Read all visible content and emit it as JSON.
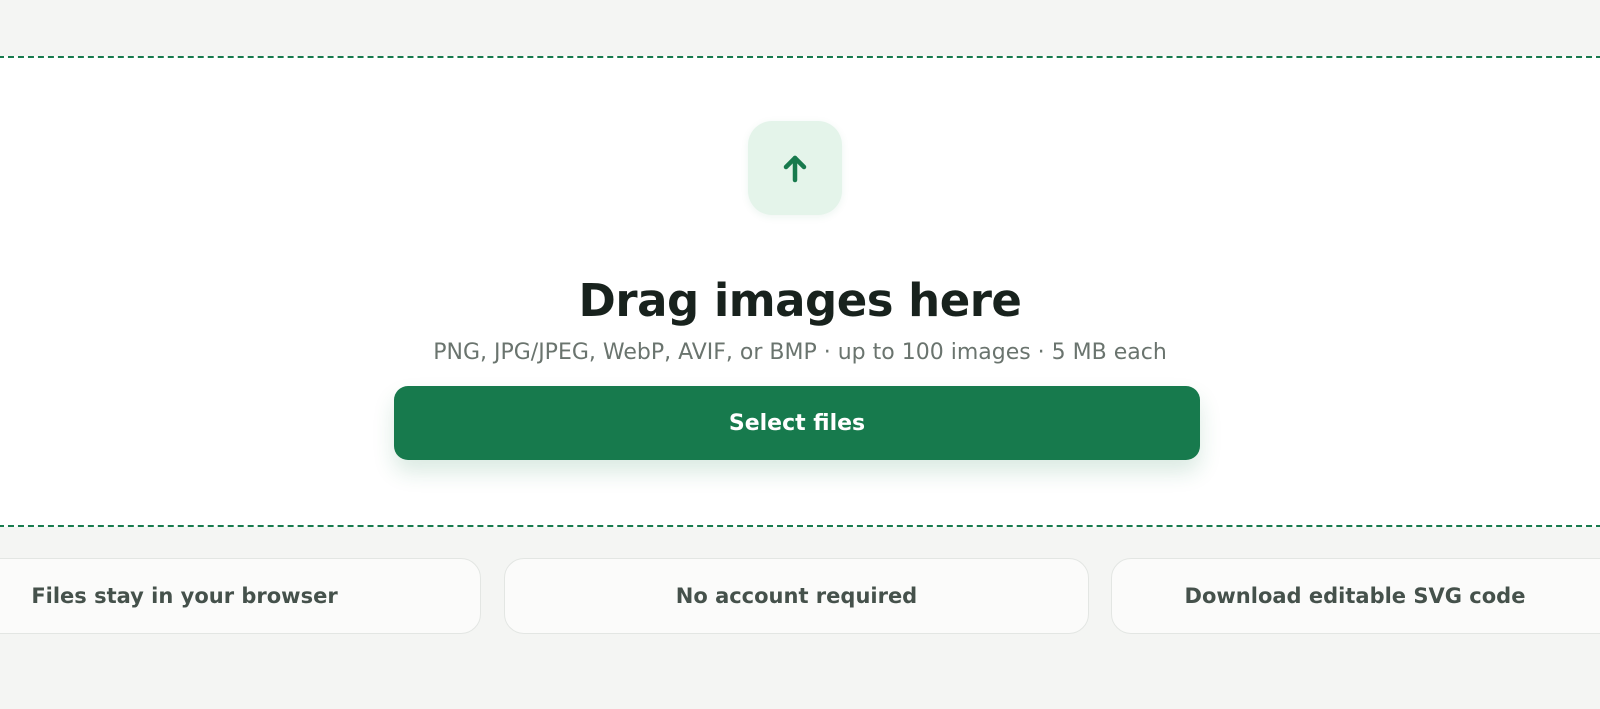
{
  "upload": {
    "icon": "upload-arrow-icon",
    "title": "Drag images here",
    "subtitle": "PNG, JPG/JPEG, WebP, AVIF, or BMP · up to 100 images · 5 MB each",
    "button_label": "Select files"
  },
  "features": [
    {
      "label": "Files stay in your browser"
    },
    {
      "label": "No account required"
    },
    {
      "label": "Download editable SVG code"
    }
  ],
  "colors": {
    "accent": "#177a4d",
    "accent_soft": "#e4f4ea",
    "page_bg": "#f4f5f3",
    "text_dark": "#18221d",
    "text_muted": "#6a746e"
  }
}
